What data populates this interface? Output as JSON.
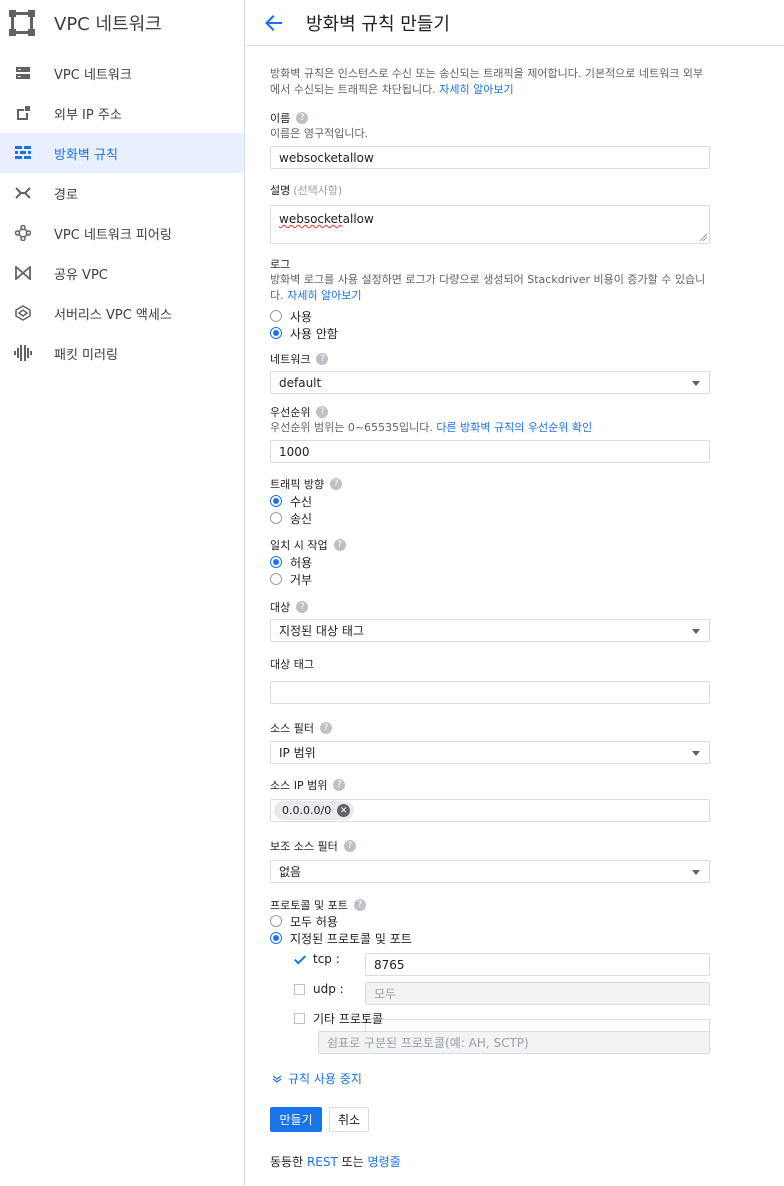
{
  "sidebar": {
    "title": "VPC 네트워크",
    "items": [
      {
        "label": "VPC 네트워크",
        "icon": "network-list-icon",
        "active": false
      },
      {
        "label": "외부 IP 주소",
        "icon": "external-ip-icon",
        "active": false
      },
      {
        "label": "방화벽 규칙",
        "icon": "firewall-icon",
        "active": true
      },
      {
        "label": "경로",
        "icon": "routes-icon",
        "active": false
      },
      {
        "label": "VPC 네트워크 피어링",
        "icon": "peering-icon",
        "active": false
      },
      {
        "label": "공유 VPC",
        "icon": "shared-vpc-icon",
        "active": false
      },
      {
        "label": "서버리스 VPC 액세스",
        "icon": "serverless-icon",
        "active": false
      },
      {
        "label": "패킷 미러링",
        "icon": "packet-mirroring-icon",
        "active": false
      }
    ]
  },
  "header": {
    "title": "방화벽 규칙 만들기"
  },
  "form": {
    "intro_text": "방화벽 규칙은 인스턴스로 수신 또는 송신되는 트래픽을 제어합니다. 기본적으로 네트워크 외부에서 수신되는 트래픽은 차단됩니다. ",
    "intro_link": "자세히 알아보기",
    "name": {
      "label": "이름",
      "hint": "이름은 영구적입니다.",
      "value": "websocketallow"
    },
    "description": {
      "label": "설명",
      "optional": "(선택사항)",
      "value": "websocket allow",
      "value_a": "websocket",
      "value_b": " allow"
    },
    "logs": {
      "label": "로그",
      "hint": "방화벽 로그를 사용 설정하면 로그가 다량으로 생성되어 Stackdriver 비용이 증가할 수 있습니다. ",
      "hint_link": "자세히 알아보기",
      "options": [
        "사용",
        "사용 안함"
      ],
      "selected": "사용 안함"
    },
    "network": {
      "label": "네트워크",
      "value": "default"
    },
    "priority": {
      "label": "우선순위",
      "hint": "우선순위 범위는 0~65535입니다. ",
      "hint_link": "다른 방화벽 규칙의 우선순위 확인",
      "value": "1000"
    },
    "direction": {
      "label": "트래픽 방향",
      "options": [
        "수신",
        "송신"
      ],
      "selected": "수신"
    },
    "action": {
      "label": "일치 시 작업",
      "options": [
        "허용",
        "거부"
      ],
      "selected": "허용"
    },
    "target": {
      "label": "대상",
      "value": "지정된 대상 태그"
    },
    "target_tags": {
      "label": "대상 태그",
      "value": ""
    },
    "source_filter": {
      "label": "소스 필터",
      "value": "IP 범위"
    },
    "source_ip": {
      "label": "소스 IP 범위",
      "chip": "0.0.0.0/0"
    },
    "secondary_filter": {
      "label": "보조 소스 필터",
      "value": "없음"
    },
    "protocols": {
      "label": "프로토콜 및 포트",
      "options": [
        "모두 허용",
        "지정된 프로토콜 및 포트"
      ],
      "selected": "지정된 프로토콜 및 포트",
      "tcp": {
        "label": "tcp :",
        "checked": true,
        "value": "8765"
      },
      "udp": {
        "label": "udp :",
        "checked": false,
        "placeholder": "모두"
      },
      "other": {
        "label": "기타 프로토콜",
        "checked": false,
        "placeholder": "쉼표로 구분된 프로토콜(예: AH, SCTP)"
      }
    },
    "disable_rule": "규칙 사용 중지",
    "create_button": "만들기",
    "cancel_button": "취소",
    "equivalent_prefix": "동등한 ",
    "rest_link": "REST",
    "or_text": " 또는 ",
    "cli_link": "명령줄"
  },
  "colors": {
    "accent": "#1a73e8",
    "active_bg": "#e8f0fe",
    "border": "#dadce0"
  }
}
